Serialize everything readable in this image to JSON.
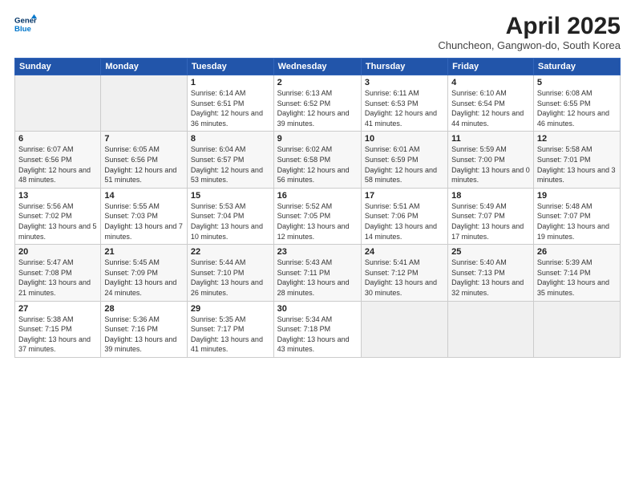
{
  "logo": {
    "line1": "General",
    "line2": "Blue"
  },
  "title": "April 2025",
  "subtitle": "Chuncheon, Gangwon-do, South Korea",
  "weekdays": [
    "Sunday",
    "Monday",
    "Tuesday",
    "Wednesday",
    "Thursday",
    "Friday",
    "Saturday"
  ],
  "weeks": [
    [
      {
        "day": "",
        "info": ""
      },
      {
        "day": "",
        "info": ""
      },
      {
        "day": "1",
        "info": "Sunrise: 6:14 AM\nSunset: 6:51 PM\nDaylight: 12 hours and 36 minutes."
      },
      {
        "day": "2",
        "info": "Sunrise: 6:13 AM\nSunset: 6:52 PM\nDaylight: 12 hours and 39 minutes."
      },
      {
        "day": "3",
        "info": "Sunrise: 6:11 AM\nSunset: 6:53 PM\nDaylight: 12 hours and 41 minutes."
      },
      {
        "day": "4",
        "info": "Sunrise: 6:10 AM\nSunset: 6:54 PM\nDaylight: 12 hours and 44 minutes."
      },
      {
        "day": "5",
        "info": "Sunrise: 6:08 AM\nSunset: 6:55 PM\nDaylight: 12 hours and 46 minutes."
      }
    ],
    [
      {
        "day": "6",
        "info": "Sunrise: 6:07 AM\nSunset: 6:56 PM\nDaylight: 12 hours and 48 minutes."
      },
      {
        "day": "7",
        "info": "Sunrise: 6:05 AM\nSunset: 6:56 PM\nDaylight: 12 hours and 51 minutes."
      },
      {
        "day": "8",
        "info": "Sunrise: 6:04 AM\nSunset: 6:57 PM\nDaylight: 12 hours and 53 minutes."
      },
      {
        "day": "9",
        "info": "Sunrise: 6:02 AM\nSunset: 6:58 PM\nDaylight: 12 hours and 56 minutes."
      },
      {
        "day": "10",
        "info": "Sunrise: 6:01 AM\nSunset: 6:59 PM\nDaylight: 12 hours and 58 minutes."
      },
      {
        "day": "11",
        "info": "Sunrise: 5:59 AM\nSunset: 7:00 PM\nDaylight: 13 hours and 0 minutes."
      },
      {
        "day": "12",
        "info": "Sunrise: 5:58 AM\nSunset: 7:01 PM\nDaylight: 13 hours and 3 minutes."
      }
    ],
    [
      {
        "day": "13",
        "info": "Sunrise: 5:56 AM\nSunset: 7:02 PM\nDaylight: 13 hours and 5 minutes."
      },
      {
        "day": "14",
        "info": "Sunrise: 5:55 AM\nSunset: 7:03 PM\nDaylight: 13 hours and 7 minutes."
      },
      {
        "day": "15",
        "info": "Sunrise: 5:53 AM\nSunset: 7:04 PM\nDaylight: 13 hours and 10 minutes."
      },
      {
        "day": "16",
        "info": "Sunrise: 5:52 AM\nSunset: 7:05 PM\nDaylight: 13 hours and 12 minutes."
      },
      {
        "day": "17",
        "info": "Sunrise: 5:51 AM\nSunset: 7:06 PM\nDaylight: 13 hours and 14 minutes."
      },
      {
        "day": "18",
        "info": "Sunrise: 5:49 AM\nSunset: 7:07 PM\nDaylight: 13 hours and 17 minutes."
      },
      {
        "day": "19",
        "info": "Sunrise: 5:48 AM\nSunset: 7:07 PM\nDaylight: 13 hours and 19 minutes."
      }
    ],
    [
      {
        "day": "20",
        "info": "Sunrise: 5:47 AM\nSunset: 7:08 PM\nDaylight: 13 hours and 21 minutes."
      },
      {
        "day": "21",
        "info": "Sunrise: 5:45 AM\nSunset: 7:09 PM\nDaylight: 13 hours and 24 minutes."
      },
      {
        "day": "22",
        "info": "Sunrise: 5:44 AM\nSunset: 7:10 PM\nDaylight: 13 hours and 26 minutes."
      },
      {
        "day": "23",
        "info": "Sunrise: 5:43 AM\nSunset: 7:11 PM\nDaylight: 13 hours and 28 minutes."
      },
      {
        "day": "24",
        "info": "Sunrise: 5:41 AM\nSunset: 7:12 PM\nDaylight: 13 hours and 30 minutes."
      },
      {
        "day": "25",
        "info": "Sunrise: 5:40 AM\nSunset: 7:13 PM\nDaylight: 13 hours and 32 minutes."
      },
      {
        "day": "26",
        "info": "Sunrise: 5:39 AM\nSunset: 7:14 PM\nDaylight: 13 hours and 35 minutes."
      }
    ],
    [
      {
        "day": "27",
        "info": "Sunrise: 5:38 AM\nSunset: 7:15 PM\nDaylight: 13 hours and 37 minutes."
      },
      {
        "day": "28",
        "info": "Sunrise: 5:36 AM\nSunset: 7:16 PM\nDaylight: 13 hours and 39 minutes."
      },
      {
        "day": "29",
        "info": "Sunrise: 5:35 AM\nSunset: 7:17 PM\nDaylight: 13 hours and 41 minutes."
      },
      {
        "day": "30",
        "info": "Sunrise: 5:34 AM\nSunset: 7:18 PM\nDaylight: 13 hours and 43 minutes."
      },
      {
        "day": "",
        "info": ""
      },
      {
        "day": "",
        "info": ""
      },
      {
        "day": "",
        "info": ""
      }
    ]
  ]
}
